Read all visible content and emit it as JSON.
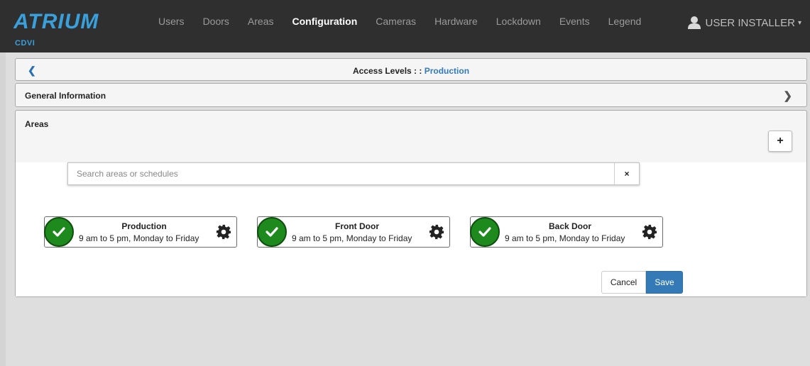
{
  "app": {
    "logo_text": "ATRIUM",
    "brand_sub": "CDVI"
  },
  "nav": [
    {
      "label": "Users"
    },
    {
      "label": "Doors"
    },
    {
      "label": "Areas"
    },
    {
      "label": "Configuration"
    },
    {
      "label": "Cameras"
    },
    {
      "label": "Hardware"
    },
    {
      "label": "Lockdown"
    },
    {
      "label": "Events"
    },
    {
      "label": "Legend"
    }
  ],
  "active_nav": "Configuration",
  "user": {
    "name": "USER INSTALLER",
    "icon": "user-icon"
  },
  "header": {
    "title": "Access Levels : : ",
    "subtitle": "Production",
    "back_icon": "chevron-left-icon"
  },
  "general": {
    "title": "General Information",
    "icon": "chevron-right-icon"
  },
  "areas": {
    "title": "Areas",
    "add_label": "+",
    "search": {
      "placeholder": "Search areas or schedules",
      "value": "",
      "clear_label": "×"
    },
    "items": [
      {
        "name": "Production",
        "schedule": "9 am to 5 pm, Monday to Friday"
      },
      {
        "name": "Front Door",
        "schedule": "9 am to 5 pm, Monday to Friday"
      },
      {
        "name": "Back Door",
        "schedule": "9 am to 5 pm, Monday to Friday"
      }
    ]
  },
  "actions": {
    "cancel_label": "Cancel",
    "save_label": "Save"
  },
  "colors": {
    "navbar": "#2f2f2f",
    "brand_sub": "#3aa0dc",
    "accent": "#337ab7",
    "check": "#1e8a1e"
  }
}
